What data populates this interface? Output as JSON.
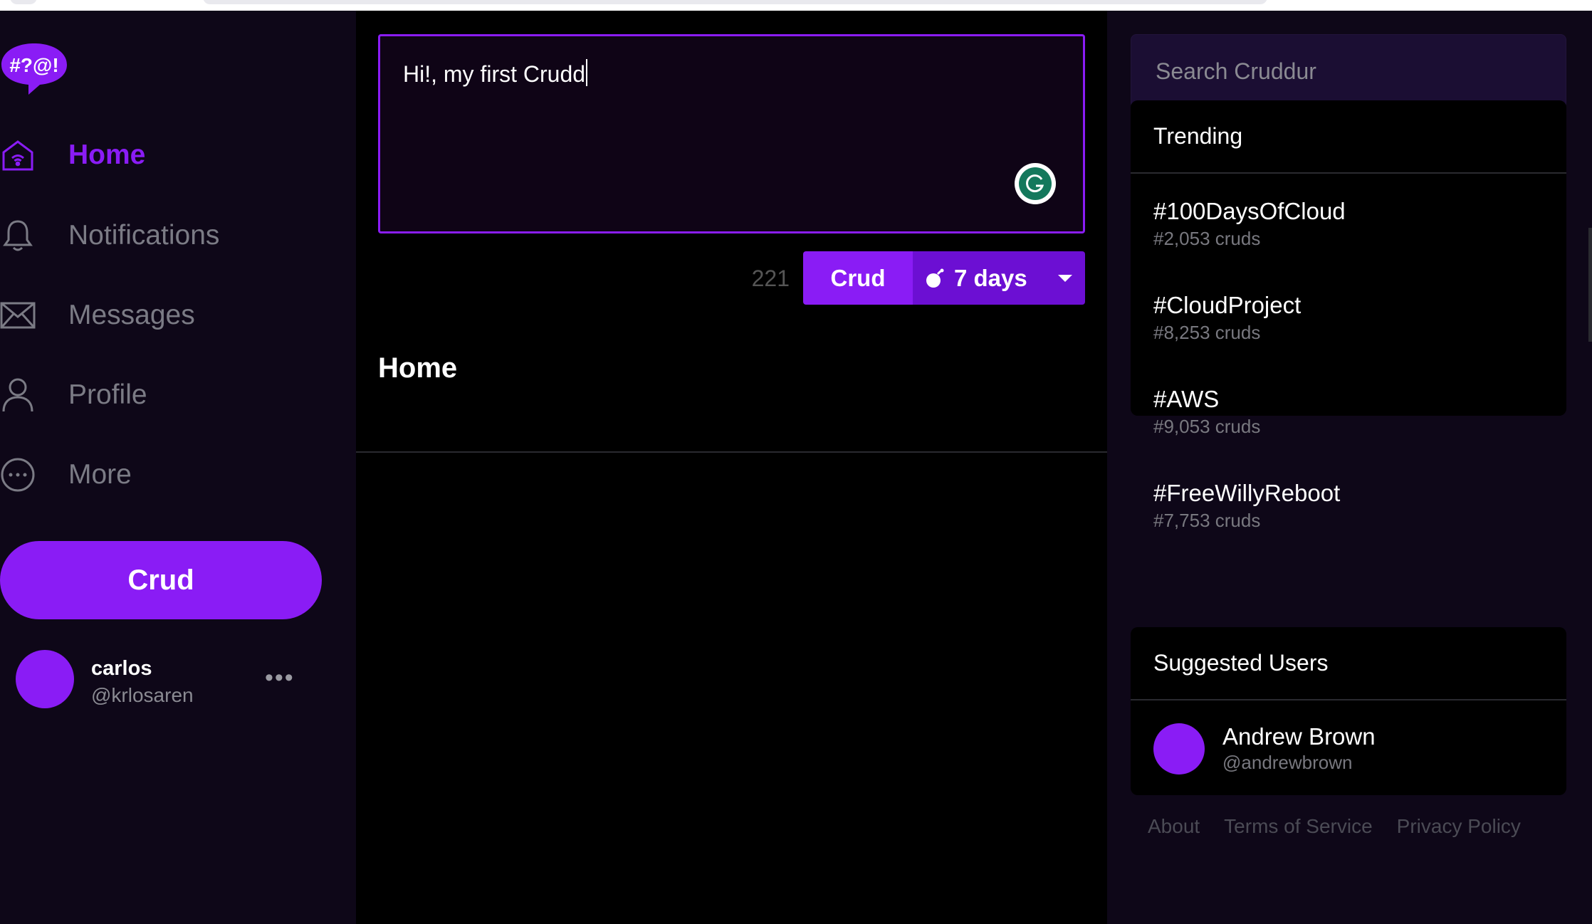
{
  "app": {
    "brand_accent": "#8a1cf5",
    "logo_text": "#?@!"
  },
  "nav": {
    "items": [
      {
        "label": "Home",
        "icon": "home-icon",
        "active": true
      },
      {
        "label": "Notifications",
        "icon": "bell-icon",
        "active": false
      },
      {
        "label": "Messages",
        "icon": "envelope-icon",
        "active": false
      },
      {
        "label": "Profile",
        "icon": "user-icon",
        "active": false
      },
      {
        "label": "More",
        "icon": "more-circle-icon",
        "active": false
      }
    ],
    "crud_button": "Crud"
  },
  "profile": {
    "name": "carlos",
    "handle": "@krlosaren",
    "more": "•••"
  },
  "composer": {
    "text": "Hi!, my first Crudd",
    "remaining_count": "221",
    "submit_label": "Crud",
    "ttl_label": "7 days"
  },
  "feed": {
    "title": "Home"
  },
  "search": {
    "placeholder": "Search Cruddur"
  },
  "trending": {
    "title": "Trending",
    "items": [
      {
        "tag": "#100DaysOfCloud",
        "count": "#2,053 cruds"
      },
      {
        "tag": "#CloudProject",
        "count": "#8,253 cruds"
      },
      {
        "tag": "#AWS",
        "count": "#9,053 cruds"
      },
      {
        "tag": "#FreeWillyReboot",
        "count": "#7,753 cruds"
      }
    ]
  },
  "suggested": {
    "title": "Suggested Users",
    "users": [
      {
        "name": "Andrew Brown",
        "handle": "@andrewbrown"
      }
    ]
  },
  "footer": {
    "links": [
      "About",
      "Terms of Service",
      "Privacy Policy"
    ]
  }
}
